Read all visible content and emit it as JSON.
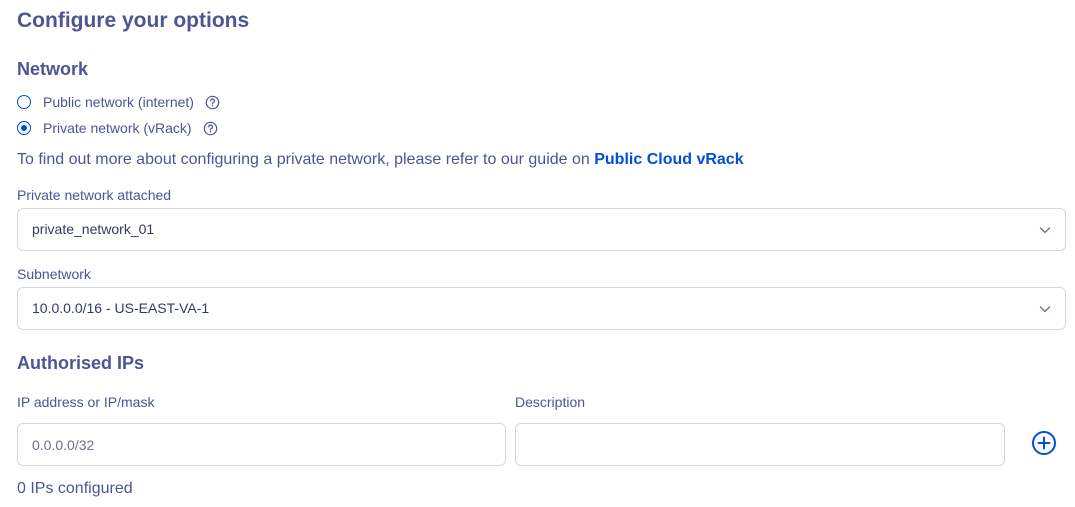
{
  "page": {
    "title": "Configure your options"
  },
  "network": {
    "heading": "Network",
    "options": [
      {
        "label": "Public network (internet)",
        "checked": false
      },
      {
        "label": "Private network (vRack)",
        "checked": true
      }
    ],
    "info_text": "To find out more about configuring a private network, please refer to our guide on ",
    "info_link": "Public Cloud vRack"
  },
  "private_network": {
    "label": "Private network attached",
    "value": "private_network_01"
  },
  "subnetwork": {
    "label": "Subnetwork",
    "value": "10.0.0.0/16 - US-EAST-VA-1"
  },
  "authorised_ips": {
    "heading": "Authorised IPs",
    "ip_label": "IP address or IP/mask",
    "ip_placeholder": "0.0.0.0/32",
    "ip_value": "",
    "description_label": "Description",
    "description_value": "",
    "count_text": "0 IPs configured"
  },
  "icons": {
    "help": "question-circle-icon",
    "chevron": "chevron-down-icon",
    "add": "plus-circle-icon"
  },
  "colors": {
    "primary_text": "#4d5592",
    "link": "#0050d7",
    "border": "#d2d8e2"
  }
}
